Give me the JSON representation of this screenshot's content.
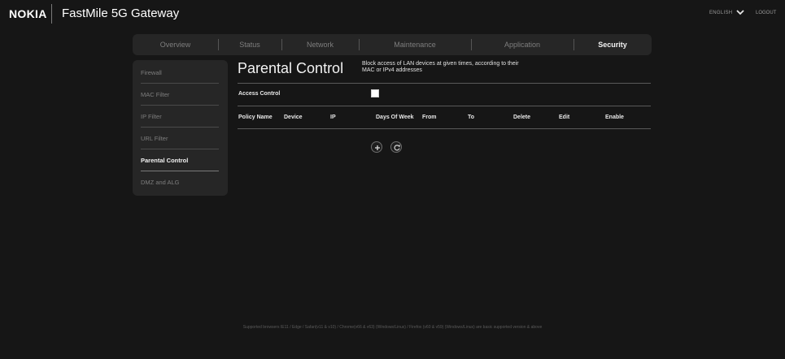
{
  "header": {
    "logo": "NOKIA",
    "product": "FastMile 5G Gateway",
    "language": "ENGLISH",
    "logout": "LOGOUT"
  },
  "tabs": [
    {
      "label": "Overview",
      "active": false
    },
    {
      "label": "Status",
      "active": false
    },
    {
      "label": "Network",
      "active": false
    },
    {
      "label": "Maintenance",
      "active": false
    },
    {
      "label": "Application",
      "active": false
    },
    {
      "label": "Security",
      "active": true
    }
  ],
  "sidebar": {
    "items": [
      {
        "label": "Firewall",
        "active": false
      },
      {
        "label": "MAC Filter",
        "active": false
      },
      {
        "label": "IP Filter",
        "active": false
      },
      {
        "label": "URL Filter",
        "active": false
      },
      {
        "label": "Parental Control",
        "active": true
      },
      {
        "label": "DMZ and ALG",
        "active": false
      }
    ]
  },
  "main": {
    "title": "Parental Control",
    "description_line1": "Block access of LAN devices at given times, according to their",
    "description_line2": "MAC or IPv4 addresses",
    "access_control_label": "Access Control",
    "access_control_checked": false,
    "table_headers": [
      "Policy Name",
      "Device",
      "IP",
      "Days Of Week",
      "From",
      "To",
      "Delete",
      "Edit",
      "Enable"
    ],
    "table_rows": []
  },
  "icons": {
    "language_dropdown": "chevron-down-icon",
    "add": "plus-icon",
    "refresh": "refresh-icon"
  },
  "footer": {
    "text": "Supported browsers IE11 / Edge / Safari(v11 & v10) / Chrome(v66 & v63) (Windows/Linux) / Firefox (v60 & v59) (Windows/Linux) are basic supported version & above"
  },
  "colors": {
    "background": "#161616",
    "panel": "#262626",
    "active_text": "#f2f2f2",
    "inactive_text": "#7e7e7e"
  }
}
